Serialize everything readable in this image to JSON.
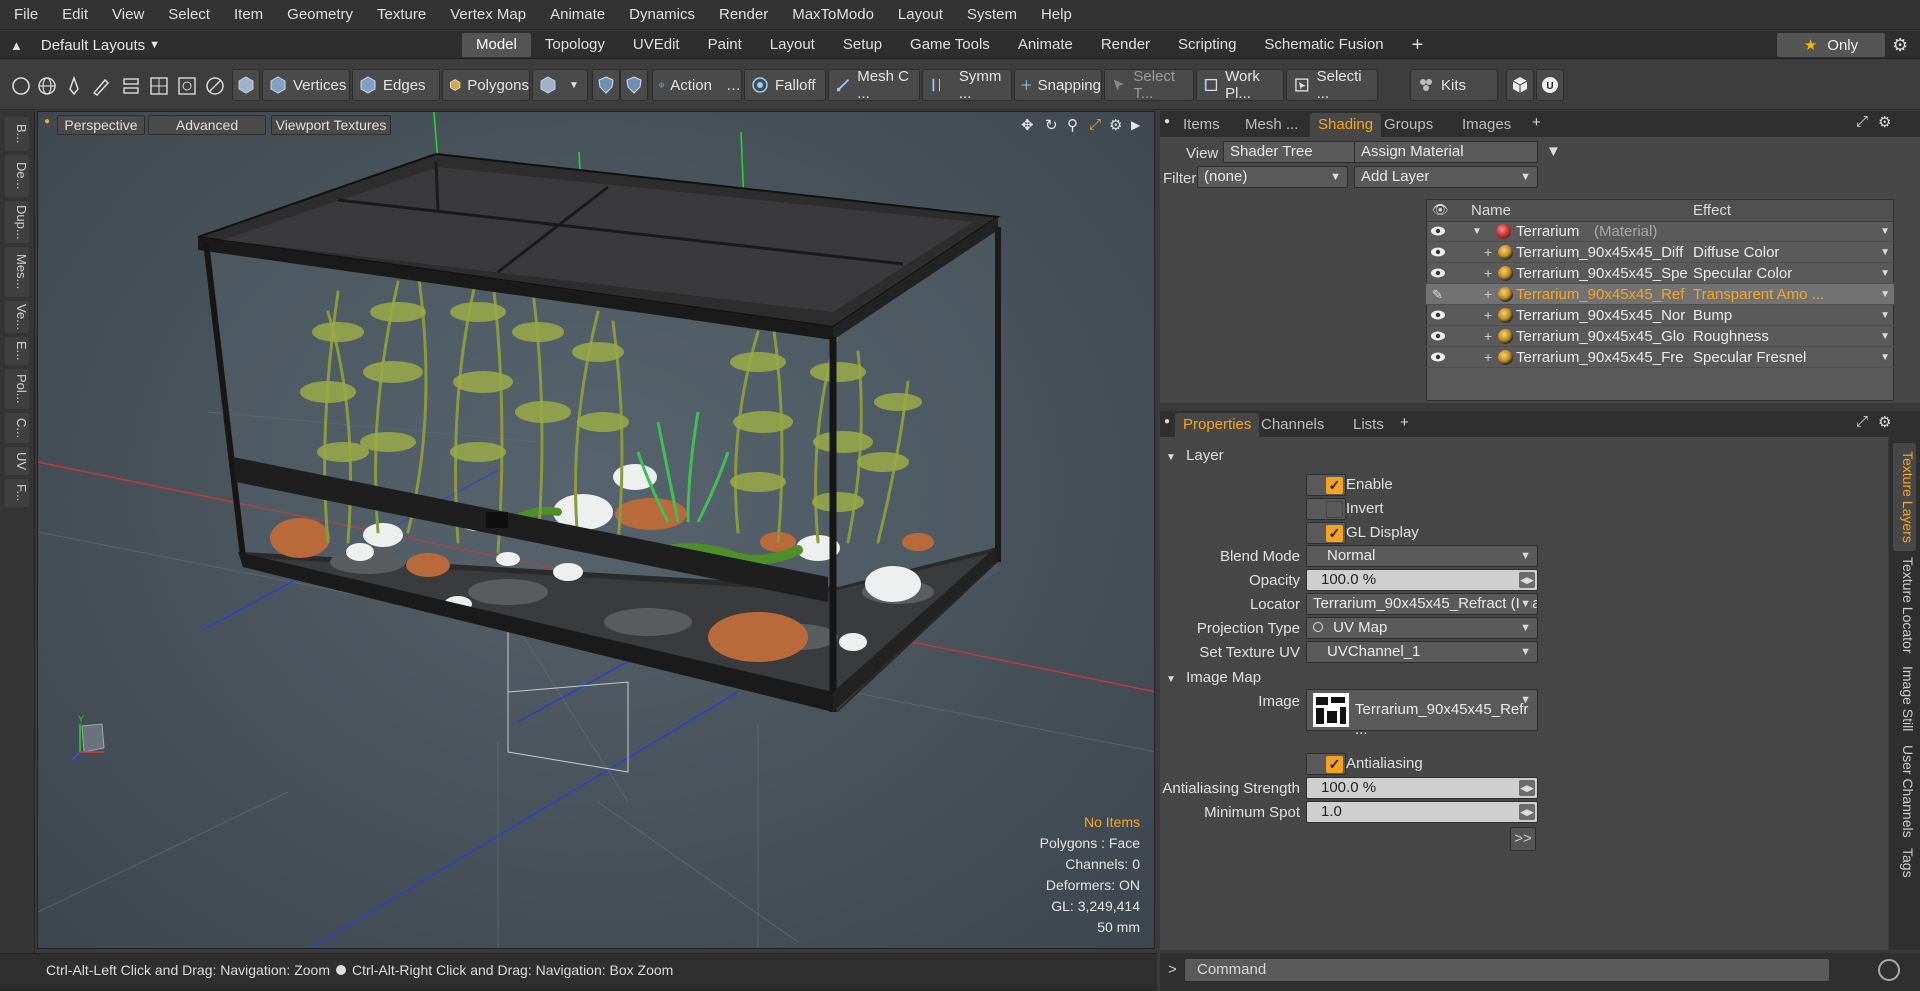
{
  "menu": [
    "File",
    "Edit",
    "View",
    "Select",
    "Item",
    "Geometry",
    "Texture",
    "Vertex Map",
    "Animate",
    "Dynamics",
    "Render",
    "MaxToModo",
    "Layout",
    "System",
    "Help"
  ],
  "layoutbar": {
    "layout_name": "Default Layouts",
    "tabs": [
      "Model",
      "Topology",
      "UVEdit",
      "Paint",
      "Layout",
      "Setup",
      "Game Tools",
      "Animate",
      "Render",
      "Scripting",
      "Schematic Fusion"
    ],
    "active_tab": "Model",
    "add_tab": "+",
    "only_label": "Only"
  },
  "toolbar": {
    "vertices": "Vertices",
    "edges": "Edges",
    "polygons": "Polygons",
    "action": "Action",
    "falloff": "Falloff",
    "mesh": "Mesh C ...",
    "symm": "Symm ...",
    "snapping": "Snapping",
    "select_t": "Select T...",
    "work_pl": "Work Pl...",
    "selecti": "Selecti ...",
    "kits": "Kits"
  },
  "left_strip": [
    "B...",
    "De...",
    "Dup...",
    "Mes...",
    "Ve...",
    "E...",
    "Pol...",
    "C...",
    "UV",
    "F..."
  ],
  "viewport": {
    "buttons": [
      "Perspective",
      "Advanced",
      "Viewport Textures"
    ],
    "info": {
      "no_items": "No Items",
      "polygons": "Polygons : Face",
      "channels": "Channels: 0",
      "deformers": "Deformers: ON",
      "gl": "GL: 3,249,414",
      "scale": "50 mm"
    }
  },
  "statusbar": {
    "left": "Ctrl-Alt-Left Click and Drag: Navigation: Zoom",
    "right": "Ctrl-Alt-Right Click and Drag: Navigation: Box Zoom"
  },
  "rp_tabs": [
    "Items",
    "Mesh ...",
    "Shading",
    "Groups",
    "Images"
  ],
  "rp_active": "Shading",
  "shading": {
    "view_label": "View",
    "view_value": "Shader Tree",
    "assign_material": "Assign Material",
    "filter_label": "Filter",
    "filter_value": "(none)",
    "add_layer": "Add Layer",
    "col_name": "Name",
    "col_effect": "Effect",
    "root": {
      "name": "Terrarium",
      "type": "(Material)"
    },
    "rows": [
      {
        "name": "Terrarium_90x45x45_Diff ...",
        "effect": "Diffuse Color"
      },
      {
        "name": "Terrarium_90x45x45_Spe ...",
        "effect": "Specular Color"
      },
      {
        "name": "Terrarium_90x45x45_Ref ...",
        "effect": "Transparent Amo ...",
        "selected": true
      },
      {
        "name": "Terrarium_90x45x45_Nor ...",
        "effect": "Bump"
      },
      {
        "name": "Terrarium_90x45x45_Glo ...",
        "effect": "Roughness"
      },
      {
        "name": "Terrarium_90x45x45_Fre ...",
        "effect": "Specular Fresnel"
      }
    ]
  },
  "prop_tabs": [
    "Properties",
    "Channels",
    "Lists"
  ],
  "properties": {
    "layer_section": "Layer",
    "enable": "Enable",
    "invert": "Invert",
    "gl_display": "GL Display",
    "blend_mode_label": "Blend Mode",
    "blend_mode": "Normal",
    "opacity_label": "Opacity",
    "opacity": "100.0 %",
    "locator_label": "Locator",
    "locator": "Terrarium_90x45x45_Refract (Ima ...",
    "projection_label": "Projection Type",
    "projection": "UV Map",
    "set_uv_label": "Set Texture UV",
    "set_uv": "UVChannel_1",
    "image_map_section": "Image Map",
    "image_label": "Image",
    "image": "Terrarium_90x45x45_Refr ...",
    "antialiasing": "Antialiasing",
    "aa_strength_label": "Antialiasing Strength",
    "aa_strength": "100.0 %",
    "min_spot_label": "Minimum Spot",
    "min_spot": "1.0",
    "more": ">>"
  },
  "side_tabs": [
    "Texture Layers",
    "Texture Locator",
    "Image Still",
    "User Channels",
    "Tags"
  ],
  "command": {
    "prompt": ">",
    "placeholder": "Command"
  },
  "colors": {
    "accent": "#f5a623",
    "panel": "#474747",
    "bg": "#333333"
  }
}
